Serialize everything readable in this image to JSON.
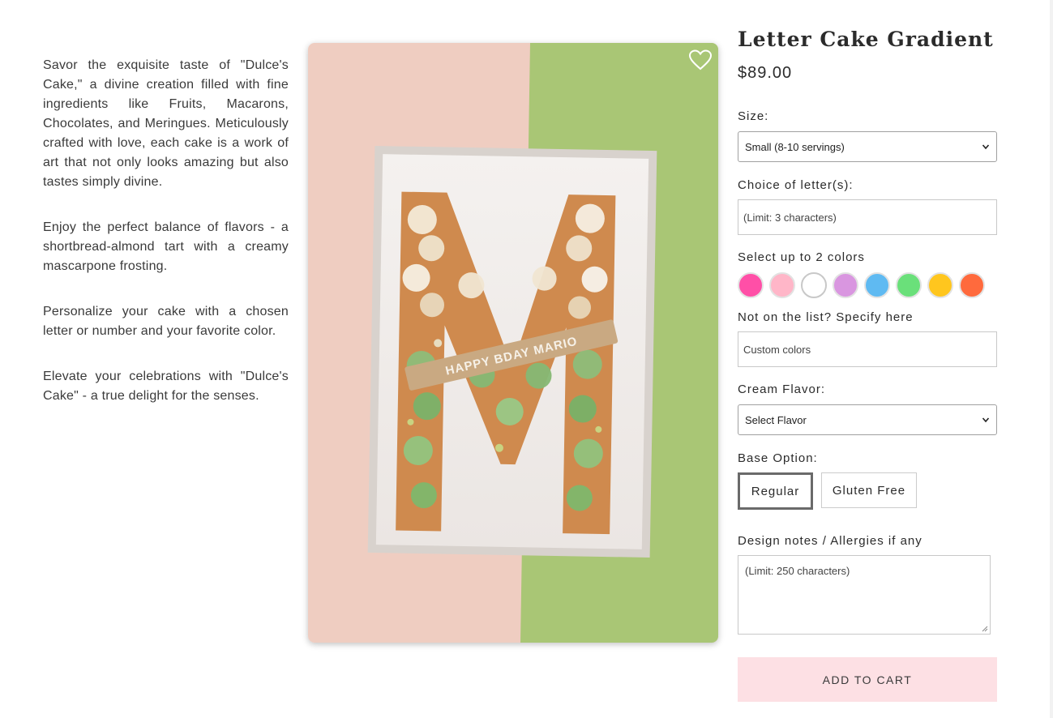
{
  "description": [
    "Savor the exquisite taste of \"Dulce's Cake,\" a divine creation filled with fine ingredients like Fruits, Macarons, Chocolates, and Meringues. Meticulously crafted with love, each cake is a work of art that not only looks amazing but also tastes simply divine.",
    "Enjoy the perfect balance of flavors - a shortbread-almond tart with a creamy mascarpone frosting.",
    "Personalize your cake with a chosen letter or number and your favorite color.",
    "Elevate your celebrations with \"Dulce's Cake\" - a true delight for the senses."
  ],
  "product": {
    "image_alt": "Letter M cake decorated with green macarons, meringues and fruit, plaque reading HAPPY BDAY MARIO",
    "cake_plaque_text": "HAPPY BDAY MARIO",
    "title": "Letter Cake Gradient",
    "price": "$89.00"
  },
  "size": {
    "label": "Size:",
    "selected": "Small (8-10 servings)"
  },
  "letters": {
    "label": "Choice of letter(s):",
    "placeholder": "(Limit: 3 characters)"
  },
  "colors": {
    "label": "Select up to 2 colors",
    "options": [
      "#ff4fa7",
      "#ffb6c8",
      "#ffffff",
      "#d996e0",
      "#5fbaf2",
      "#6ae07a",
      "#ffc61e",
      "#ff6a3d"
    ]
  },
  "custom_colors": {
    "label": "Not on the list? Specify here",
    "placeholder": "Custom colors"
  },
  "cream": {
    "label": "Cream Flavor:",
    "selected": "Select Flavor"
  },
  "base": {
    "label": "Base Option:",
    "options": [
      "Regular",
      "Gluten Free"
    ],
    "selected": "Regular"
  },
  "notes": {
    "label": "Design notes / Allergies if any",
    "placeholder": "(Limit: 250 characters)"
  },
  "cart": {
    "label": "ADD TO CART"
  },
  "icons": {
    "favorite": "heart-outline-icon",
    "dropdown": "chevron-down-icon"
  }
}
